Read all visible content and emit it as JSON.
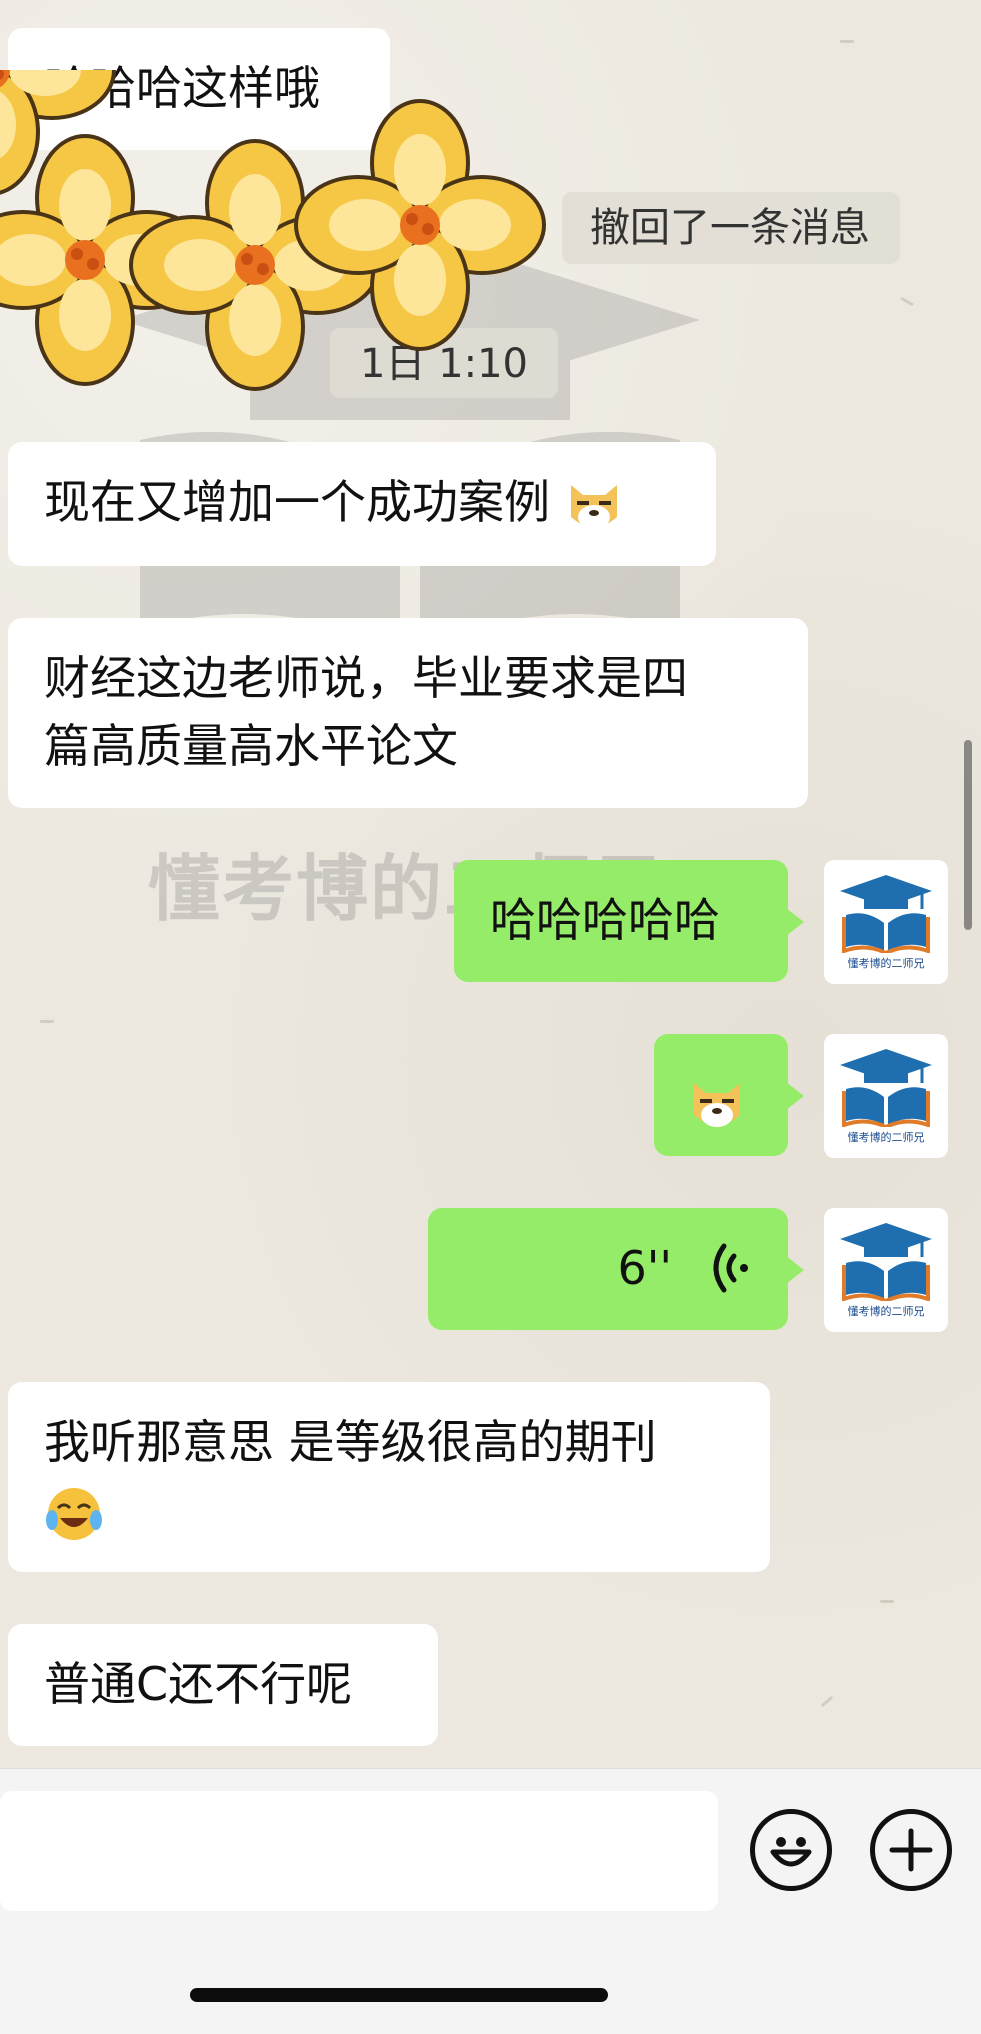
{
  "messages": [
    {
      "id": "m1",
      "side": "left",
      "text": "哈哈哈这样哦"
    },
    {
      "id": "recall",
      "type": "system",
      "text": "撤回了一条消息"
    },
    {
      "id": "time",
      "type": "system",
      "text": "1日 1:10"
    },
    {
      "id": "m2",
      "side": "left",
      "text": "现在又增加一个成功案例",
      "emoji": "doge-face-icon"
    },
    {
      "id": "m3",
      "side": "left",
      "line1": "财经这边老师说，毕业要求是四",
      "line2": "篇高质量高水平论文"
    },
    {
      "id": "m4",
      "side": "right",
      "text": "哈哈哈哈哈"
    },
    {
      "id": "m5",
      "side": "right",
      "emoji": "doge-face-icon"
    },
    {
      "id": "m6",
      "side": "right",
      "type": "voice",
      "duration": "6''"
    },
    {
      "id": "m7",
      "side": "left",
      "line1": "我听那意思 是等级很高的期刊",
      "emoji": "laughing-crying-face-icon"
    },
    {
      "id": "m8",
      "side": "left",
      "text": "普通C还不行呢"
    }
  ],
  "avatar": {
    "caption": "懂考博的二师兄",
    "icon": "graduation-book-logo"
  },
  "watermark": {
    "text": "懂考博的二师兄"
  },
  "sticker": {
    "icon": "yellow-flowers-sticker"
  },
  "colors": {
    "sent_bubble": "#95ec69",
    "received_bubble": "#ffffff",
    "chat_bg": "#ece8df",
    "logo_blue": "#1f6fb0",
    "logo_orange": "#e07b2a"
  },
  "input_bar": {
    "emoji_button": "smiley-icon",
    "plus_button": "plus-icon"
  }
}
